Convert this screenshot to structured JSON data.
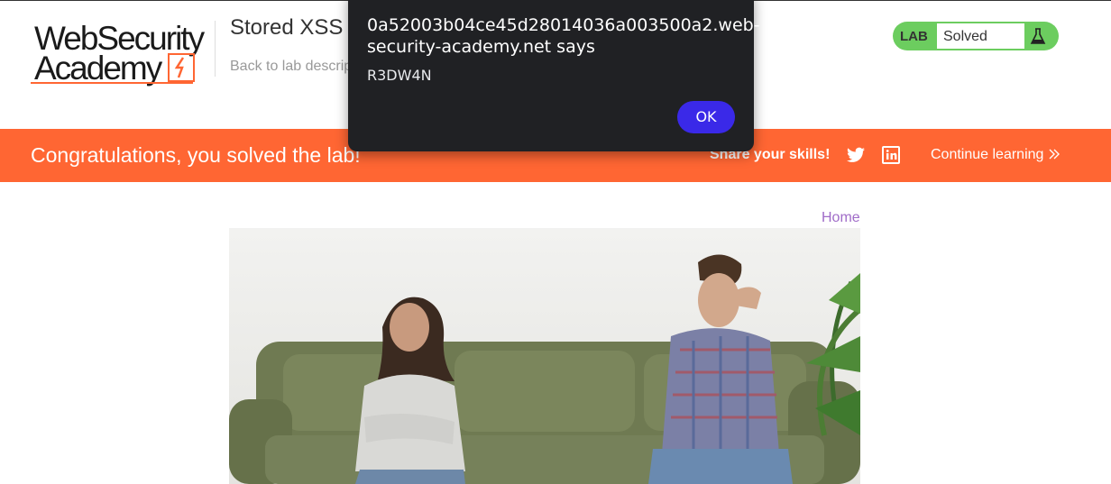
{
  "header": {
    "logo_line1": "WebSecurity",
    "logo_line2": "Academy",
    "lab_title": "Stored XSS",
    "back_link": "Back to lab descrip",
    "lab_tag": "LAB",
    "lab_status": "Solved"
  },
  "banner": {
    "congrats": "Congratulations, you solved the lab!",
    "share": "Share your skills!",
    "continue": "Continue learning"
  },
  "nav": {
    "home": "Home"
  },
  "dialog": {
    "title": "0a52003b04ce45d28014036a003500a2.web-security-academy.net says",
    "message": "R3DW4N",
    "ok": "OK"
  },
  "colors": {
    "brand_orange": "#ff6633",
    "lab_green": "#6ccd5f",
    "dialog_bg": "#202124",
    "ok_button": "#3a29e8",
    "link_purple": "#a06cc8"
  },
  "icons": [
    "flask-icon",
    "twitter-icon",
    "linkedin-icon",
    "chevron-right-double-icon"
  ]
}
